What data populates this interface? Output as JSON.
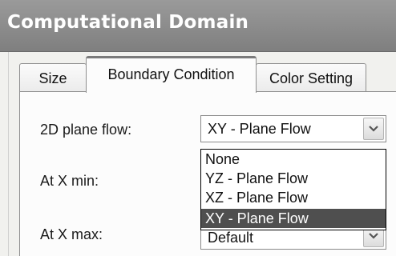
{
  "window": {
    "title": "Computational Domain"
  },
  "tabs": [
    {
      "label": "Size",
      "active": false
    },
    {
      "label": "Boundary Condition",
      "active": true
    },
    {
      "label": "Color Setting",
      "active": false
    }
  ],
  "form": {
    "plane_flow": {
      "label": "2D plane flow:",
      "value": "XY - Plane Flow",
      "options": [
        "None",
        "YZ - Plane Flow",
        "XZ - Plane Flow",
        "XY - Plane Flow"
      ],
      "highlighted": "XY - Plane Flow"
    },
    "x_min": {
      "label": "At X min:"
    },
    "x_max": {
      "label": "At X max:",
      "value": "Default"
    }
  },
  "icons": {
    "dropdown_arrow": "chevron-down-icon"
  },
  "colors": {
    "titlebar": "#8e8e8e",
    "selection": "#4f4f4f"
  }
}
